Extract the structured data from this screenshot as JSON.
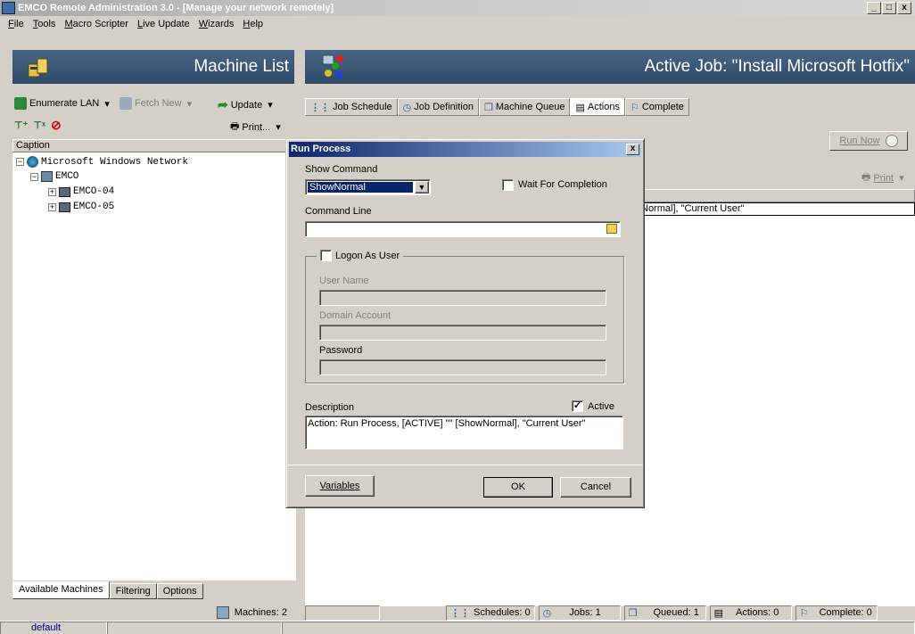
{
  "window": {
    "title": "EMCO Remote Administration 3.0 - [Manage your network remotely]",
    "min": "_",
    "max": "□",
    "close": "x"
  },
  "menu": [
    "File",
    "Tools",
    "Macro Scripter",
    "Live Update",
    "Wizards",
    "Help"
  ],
  "left_panel": {
    "title": "Machine List",
    "toolbar": {
      "enumerate": "Enumerate LAN",
      "fetch": "Fetch New",
      "update": "Update",
      "print": "Print..."
    },
    "caption_header": "Caption",
    "tree": {
      "root": "Microsoft Windows Network",
      "group": "EMCO",
      "machines": [
        "EMCO-04",
        "EMCO-05"
      ]
    },
    "tabs": [
      "Available Machines",
      "Filtering",
      "Options"
    ],
    "status_machines": "Machines: 2"
  },
  "right_panel": {
    "title": "Active Job: \"Install Microsoft Hotfix\"",
    "tabs": [
      "Job Schedule",
      "Job Definition",
      "Machine Queue",
      "Actions",
      "Complete"
    ],
    "run_now": "Run Now",
    "print": "Print",
    "action_row": "Normal], \"Current User\"",
    "status": {
      "schedules": "Schedules: 0",
      "jobs": "Jobs: 1",
      "queued": "Queued: 1",
      "actions": "Actions: 0",
      "complete": "Complete: 0"
    }
  },
  "dialog": {
    "title": "Run Process",
    "close": "x",
    "show_command_label": "Show Command",
    "show_command_value": "ShowNormal",
    "wait_for_completion": "Wait For Completion",
    "command_line_label": "Command Line",
    "command_line_value": "",
    "logon_as_user": "Logon As User",
    "user_name": "User Name",
    "domain_account": "Domain Account",
    "password": "Password",
    "description_label": "Description",
    "active_label": "Active",
    "active_check": "✓",
    "description_value": "Action: Run Process, [ACTIVE] \"\" [ShowNormal], \"Current User\"",
    "variables_btn": "Variables",
    "ok_btn": "OK",
    "cancel_btn": "Cancel"
  },
  "bottom_status": {
    "profile": "default"
  }
}
